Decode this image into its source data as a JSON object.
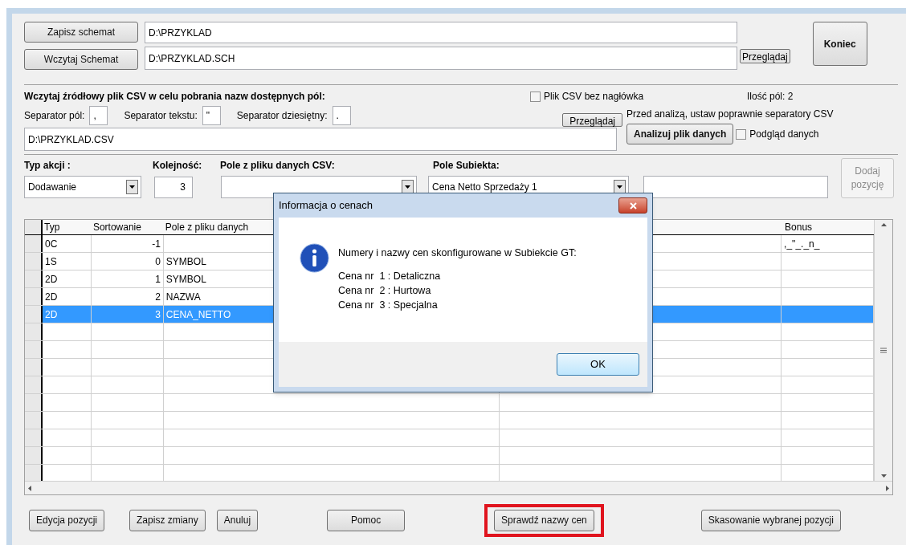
{
  "schema": {
    "save_button": "Zapisz schemat",
    "save_path": "D:\\PRZYKLAD",
    "load_button": "Wczytaj Schemat",
    "load_path": "D:\\PRZYKLAD.SCH",
    "browse_button": "Przeglądaj",
    "exit_button": "Koniec"
  },
  "csv": {
    "heading": "Wczytaj źródłowy plik CSV w celu pobrania nazw dostępnych pól:",
    "no_header": {
      "label": "Plik CSV bez nagłówka",
      "checked": false
    },
    "field_count": "Ilość pól: 2",
    "separators": [
      {
        "label": "Separator pól:",
        "value": ","
      },
      {
        "label": "Separator tekstu:",
        "value": "\""
      },
      {
        "label": "Separator dziesiętny:",
        "value": "."
      }
    ],
    "browse_button": "Przeglądaj",
    "hint": "Przed analizą, ustaw poprawnie separatory CSV",
    "path": "D:\\PRZYKLAD.CSV",
    "analyze_button": "Analizuj plik danych",
    "preview": {
      "label": "Podgląd danych",
      "checked": false
    }
  },
  "action": {
    "type_label": "Typ akcji :",
    "type_value": "Dodawanie",
    "order_label": "Kolejność:",
    "order_value": "3",
    "csv_field_label": "Pole z pliku danych CSV:",
    "subiekt_field_label": "Pole Subiekta:",
    "subiekt_field_value": "Cena Netto Sprzedaży 1",
    "add_button": {
      "label": "Dodaj pozycję",
      "disabled": true
    }
  },
  "table": {
    "columns": [
      "Typ",
      "Sortowanie",
      "Pole z pliku danych",
      "Bonus"
    ],
    "rows": [
      {
        "typ": "0C",
        "sort": "-1",
        "field": "",
        "bonus": ",_\"_._n_",
        "selected": false
      },
      {
        "typ": "1S",
        "sort": "0",
        "field": "SYMBOL",
        "bonus": "",
        "selected": false
      },
      {
        "typ": "2D",
        "sort": "1",
        "field": "SYMBOL",
        "bonus": "",
        "selected": false
      },
      {
        "typ": "2D",
        "sort": "2",
        "field": "NAZWA",
        "bonus": "",
        "selected": false
      },
      {
        "typ": "2D",
        "sort": "3",
        "field": "CENA_NETTO",
        "bonus": "",
        "selected": true
      }
    ]
  },
  "buttons": [
    {
      "label": "Edycja pozycji",
      "highlighted": false
    },
    {
      "label": "Zapisz zmiany",
      "highlighted": false
    },
    {
      "label": "Anuluj",
      "highlighted": false
    },
    {
      "label": "Pomoc",
      "highlighted": false
    },
    {
      "label": "Sprawdź nazwy cen",
      "highlighted": true
    },
    {
      "label": "Skasowanie wybranej pozycji",
      "highlighted": false
    }
  ],
  "dialog": {
    "title": "Informacja o cenach",
    "message": "Numery i nazwy cen skonfigurowane w Subiekcie GT:",
    "lines": [
      "Cena nr  1 : Detaliczna",
      "Cena nr  2 : Hurtowa",
      "Cena nr  3 : Specjalna"
    ],
    "ok_button": "OK"
  }
}
